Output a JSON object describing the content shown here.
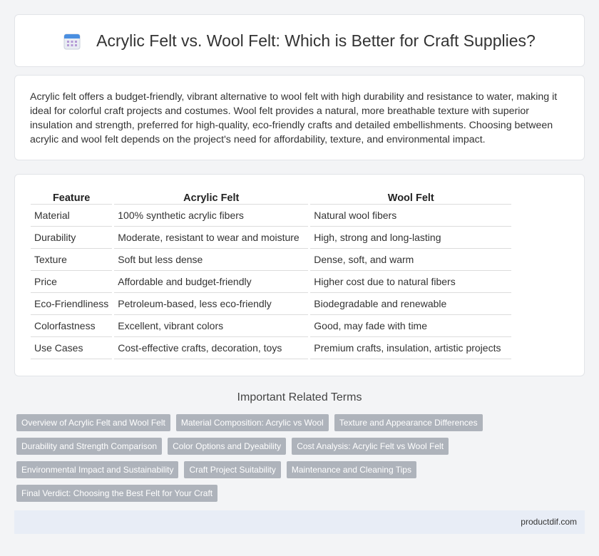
{
  "header": {
    "title": "Acrylic Felt vs. Wool Felt: Which is Better for Craft Supplies?",
    "icon": "calendar-icon"
  },
  "intro": {
    "text": "Acrylic felt offers a budget-friendly, vibrant alternative to wool felt with high durability and resistance to water, making it ideal for colorful craft projects and costumes. Wool felt provides a natural, more breathable texture with superior insulation and strength, preferred for high-quality, eco-friendly crafts and detailed embellishments. Choosing between acrylic and wool felt depends on the project's need for affordability, texture, and environmental impact."
  },
  "table": {
    "headers": [
      "Feature",
      "Acrylic Felt",
      "Wool Felt"
    ],
    "rows": [
      [
        "Material",
        "100% synthetic acrylic fibers",
        "Natural wool fibers"
      ],
      [
        "Durability",
        "Moderate, resistant to wear and moisture",
        "High, strong and long-lasting"
      ],
      [
        "Texture",
        "Soft but less dense",
        "Dense, soft, and warm"
      ],
      [
        "Price",
        "Affordable and budget-friendly",
        "Higher cost due to natural fibers"
      ],
      [
        "Eco-Friendliness",
        "Petroleum-based, less eco-friendly",
        "Biodegradable and renewable"
      ],
      [
        "Colorfastness",
        "Excellent, vibrant colors",
        "Good, may fade with time"
      ],
      [
        "Use Cases",
        "Cost-effective crafts, decoration, toys",
        "Premium crafts, insulation, artistic projects"
      ]
    ]
  },
  "terms": {
    "title": "Important Related Terms",
    "items": [
      "Overview of Acrylic Felt and Wool Felt",
      "Material Composition: Acrylic vs Wool",
      "Texture and Appearance Differences",
      "Durability and Strength Comparison",
      "Color Options and Dyeability",
      "Cost Analysis: Acrylic Felt vs Wool Felt",
      "Environmental Impact and Sustainability",
      "Craft Project Suitability",
      "Maintenance and Cleaning Tips",
      "Final Verdict: Choosing the Best Felt for Your Craft"
    ]
  },
  "footer": {
    "site": "productdif.com"
  },
  "colors": {
    "page_bg": "#f3f4f6",
    "tag_bg": "#aeb3bb",
    "footer_bg": "#e8edf6",
    "icon_accent": "#4a8fe0"
  }
}
